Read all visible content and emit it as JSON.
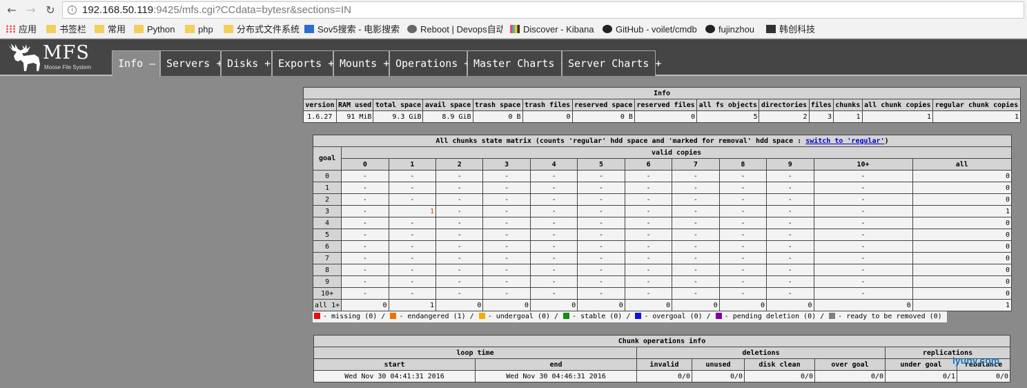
{
  "browser": {
    "url_host": "192.168.50.119",
    "url_rest": ":9425/mfs.cgi?CCdata=bytesr&sections=IN",
    "bookmarks": [
      "应用",
      "书签栏",
      "常用",
      "Python",
      "php",
      "分布式文件系统",
      "Sov5搜索 - 电影搜索",
      "Reboot | Devops自动",
      "Discover - Kibana",
      "GitHub - voilet/cmdb",
      "fujinzhou",
      "韩创科技"
    ]
  },
  "mfs": {
    "logo": "MFS",
    "logo_sub": "Moose File System",
    "tabs": [
      "Info —",
      "Servers +",
      "Disks +",
      "Exports +",
      "Mounts +",
      "Operations +",
      "Master Charts +",
      "Server Charts +"
    ]
  },
  "info": {
    "title": "Info",
    "headers": [
      "version",
      "RAM used",
      "total space",
      "avail space",
      "trash space",
      "trash files",
      "reserved space",
      "reserved files",
      "all fs objects",
      "directories",
      "files",
      "chunks",
      "all chunk copies",
      "regular chunk copies"
    ],
    "values": [
      "1.6.27",
      "91 MiB",
      "9.3 GiB",
      "8.9 GiB",
      "0 B",
      "0",
      "0 B",
      "0",
      "5",
      "2",
      "3",
      "1",
      "1",
      "1"
    ]
  },
  "matrix": {
    "title": "All chunks state matrix (counts 'regular' hdd space and 'marked for removal' hdd space : ",
    "switch_link": "switch to 'regular'",
    "title_end": ")",
    "goal_label": "goal",
    "valid_label": "valid copies",
    "cols": [
      "0",
      "1",
      "2",
      "3",
      "4",
      "5",
      "6",
      "7",
      "8",
      "9",
      "10+",
      "all"
    ],
    "rows": [
      {
        "goal": "0",
        "cells": [
          "-",
          "-",
          "-",
          "-",
          "-",
          "-",
          "-",
          "-",
          "-",
          "-",
          "-",
          "0"
        ]
      },
      {
        "goal": "1",
        "cells": [
          "-",
          "-",
          "-",
          "-",
          "-",
          "-",
          "-",
          "-",
          "-",
          "-",
          "-",
          "0"
        ]
      },
      {
        "goal": "2",
        "cells": [
          "-",
          "-",
          "-",
          "-",
          "-",
          "-",
          "-",
          "-",
          "-",
          "-",
          "-",
          "0"
        ]
      },
      {
        "goal": "3",
        "cells": [
          "-",
          "1",
          "-",
          "-",
          "-",
          "-",
          "-",
          "-",
          "-",
          "-",
          "-",
          "1"
        ]
      },
      {
        "goal": "4",
        "cells": [
          "-",
          "-",
          "-",
          "-",
          "-",
          "-",
          "-",
          "-",
          "-",
          "-",
          "-",
          "0"
        ]
      },
      {
        "goal": "5",
        "cells": [
          "-",
          "-",
          "-",
          "-",
          "-",
          "-",
          "-",
          "-",
          "-",
          "-",
          "-",
          "0"
        ]
      },
      {
        "goal": "6",
        "cells": [
          "-",
          "-",
          "-",
          "-",
          "-",
          "-",
          "-",
          "-",
          "-",
          "-",
          "-",
          "0"
        ]
      },
      {
        "goal": "7",
        "cells": [
          "-",
          "-",
          "-",
          "-",
          "-",
          "-",
          "-",
          "-",
          "-",
          "-",
          "-",
          "0"
        ]
      },
      {
        "goal": "8",
        "cells": [
          "-",
          "-",
          "-",
          "-",
          "-",
          "-",
          "-",
          "-",
          "-",
          "-",
          "-",
          "0"
        ]
      },
      {
        "goal": "9",
        "cells": [
          "-",
          "-",
          "-",
          "-",
          "-",
          "-",
          "-",
          "-",
          "-",
          "-",
          "-",
          "0"
        ]
      },
      {
        "goal": "10+",
        "cells": [
          "-",
          "-",
          "-",
          "-",
          "-",
          "-",
          "-",
          "-",
          "-",
          "-",
          "-",
          "0"
        ]
      },
      {
        "goal": "all 1+",
        "cells": [
          "0",
          "1",
          "0",
          "0",
          "0",
          "0",
          "0",
          "0",
          "0",
          "0",
          "0",
          "1"
        ]
      }
    ],
    "legend": [
      {
        "color": "#e01010",
        "text": "- missing (0) /"
      },
      {
        "color": "#f07000",
        "text": "- endangered (1) /"
      },
      {
        "color": "#f0b000",
        "text": "- undergoal (0) /"
      },
      {
        "color": "#109010",
        "text": "- stable (0) /"
      },
      {
        "color": "#1010e0",
        "text": "- overgoal (0) /"
      },
      {
        "color": "#8000a0",
        "text": "- pending deletion (0) /"
      },
      {
        "color": "#808080",
        "text": "- ready to be removed (0)"
      }
    ]
  },
  "ops": {
    "title": "Chunk operations info",
    "groups": [
      "loop time",
      "deletions",
      "replications"
    ],
    "cols": [
      "start",
      "end",
      "invalid",
      "unused",
      "disk clean",
      "over goal",
      "under goal",
      "rebalance"
    ],
    "values": [
      "Wed Nov 30 04:41:31 2016",
      "Wed Nov 30 04:46:31 2016",
      "0/0",
      "0/0",
      "0/0",
      "0/0",
      "0/1",
      "0/0"
    ]
  },
  "watermark": "iyunv.com"
}
